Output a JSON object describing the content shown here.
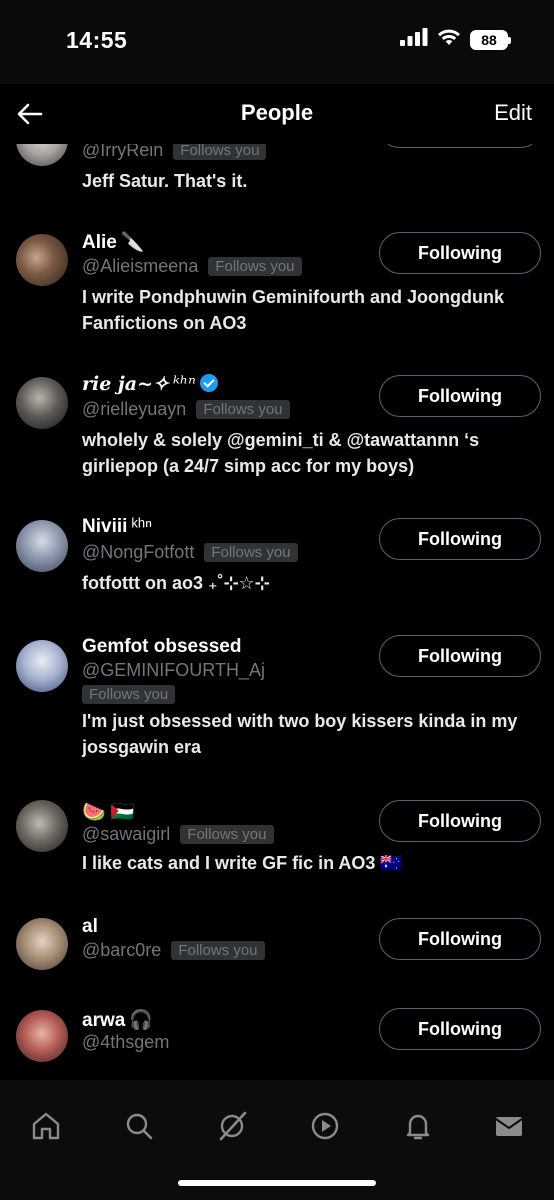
{
  "status_bar": {
    "time": "14:55",
    "battery": "88"
  },
  "header": {
    "title": "People",
    "edit_label": "Edit"
  },
  "people": [
    {
      "name": "",
      "handle": "@IrryRein",
      "follows_you": "Follows you",
      "bio": "Jeff Satur. That's it.",
      "button": ""
    },
    {
      "name": "Alie",
      "name_extra": "🔪",
      "handle": "@Alieismeena",
      "follows_you": "Follows you",
      "bio": "I write Pondphuwin Geminifourth and Joongdunk Fanfictions on AO3",
      "button": "Following"
    },
    {
      "name": "rie ja~✧",
      "name_extra": "ᵏʰⁿ",
      "handle": "@rielleyuayn",
      "follows_you": "Follows you",
      "bio": "wholely & solely @gemini_ti & @tawattannn ‘s girliepop (a 24/7 simp acc for my boys)",
      "button": "Following"
    },
    {
      "name": "Niviii",
      "name_extra": "ᵏʰⁿ",
      "handle": "@NongFotfott",
      "follows_you": "Follows you",
      "bio": "fotfottt on ao3 ₊˚⊹☆⊹",
      "button": "Following"
    },
    {
      "name": "Gemfot obsessed",
      "handle": "@GEMINIFOURTH_Aj",
      "follows_you": "Follows you",
      "bio": "I'm just obsessed with two boy kissers kinda in my jossgawin era",
      "button": "Following"
    },
    {
      "name": "🍉 🇵🇸",
      "handle": "@sawaigirl",
      "follows_you": "Follows you",
      "bio": "I like cats and I write GF fic in AO3 🇦🇺",
      "button": "Following"
    },
    {
      "name": "al",
      "handle": "@barc0re",
      "follows_you": "Follows you",
      "button": "Following"
    },
    {
      "name": "arwa",
      "name_extra": "🎧",
      "handle": "@4thsgem",
      "button": "Following"
    }
  ],
  "tab_bar": [
    "home-icon",
    "search-icon",
    "grok-icon",
    "video-icon",
    "notifications-icon",
    "messages-icon"
  ]
}
